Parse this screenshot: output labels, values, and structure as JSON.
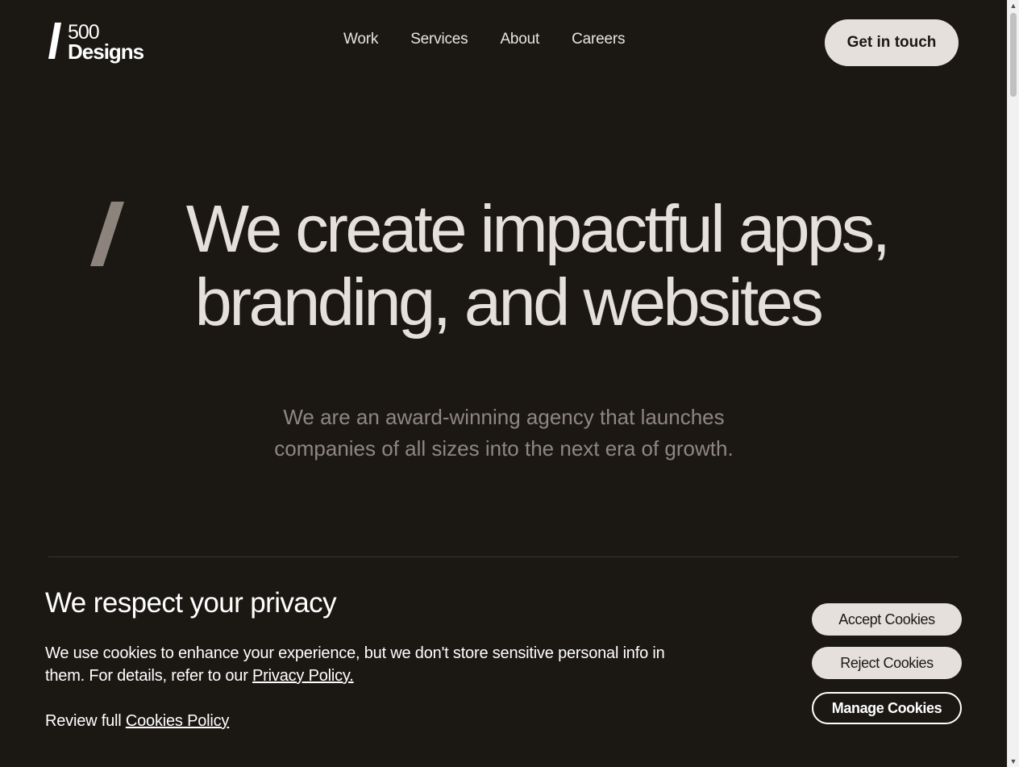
{
  "header": {
    "logo": {
      "line1": "500",
      "line2": "Designs"
    },
    "nav": [
      {
        "label": "Work"
      },
      {
        "label": "Services"
      },
      {
        "label": "About"
      },
      {
        "label": "Careers"
      }
    ],
    "cta_label": "Get in touch"
  },
  "hero": {
    "title_line1": "We create impactful apps,",
    "title_line2": "branding, and websites",
    "subtitle_line1": "We are an award-winning agency that launches",
    "subtitle_line2": "companies of all sizes into the next era of growth."
  },
  "cookie_banner": {
    "title": "We respect your privacy",
    "text": "We use cookies to enhance your experience, but we don't store sensitive personal info in them. For details, refer to our",
    "privacy_link": "Privacy Policy.",
    "review_text": "Review full",
    "cookies_link": "Cookies Policy",
    "buttons": {
      "accept": "Accept Cookies",
      "reject": "Reject Cookies",
      "manage": "Manage Cookies"
    }
  },
  "scrollbar": {
    "up_icon": "▲",
    "down_icon": "▼"
  },
  "colors": {
    "background": "#1b1814",
    "light_button": "#e5e0db",
    "hero_text": "#e5e0dc",
    "subtitle_text": "#8f877f",
    "accent_slash": "#8c847c"
  }
}
